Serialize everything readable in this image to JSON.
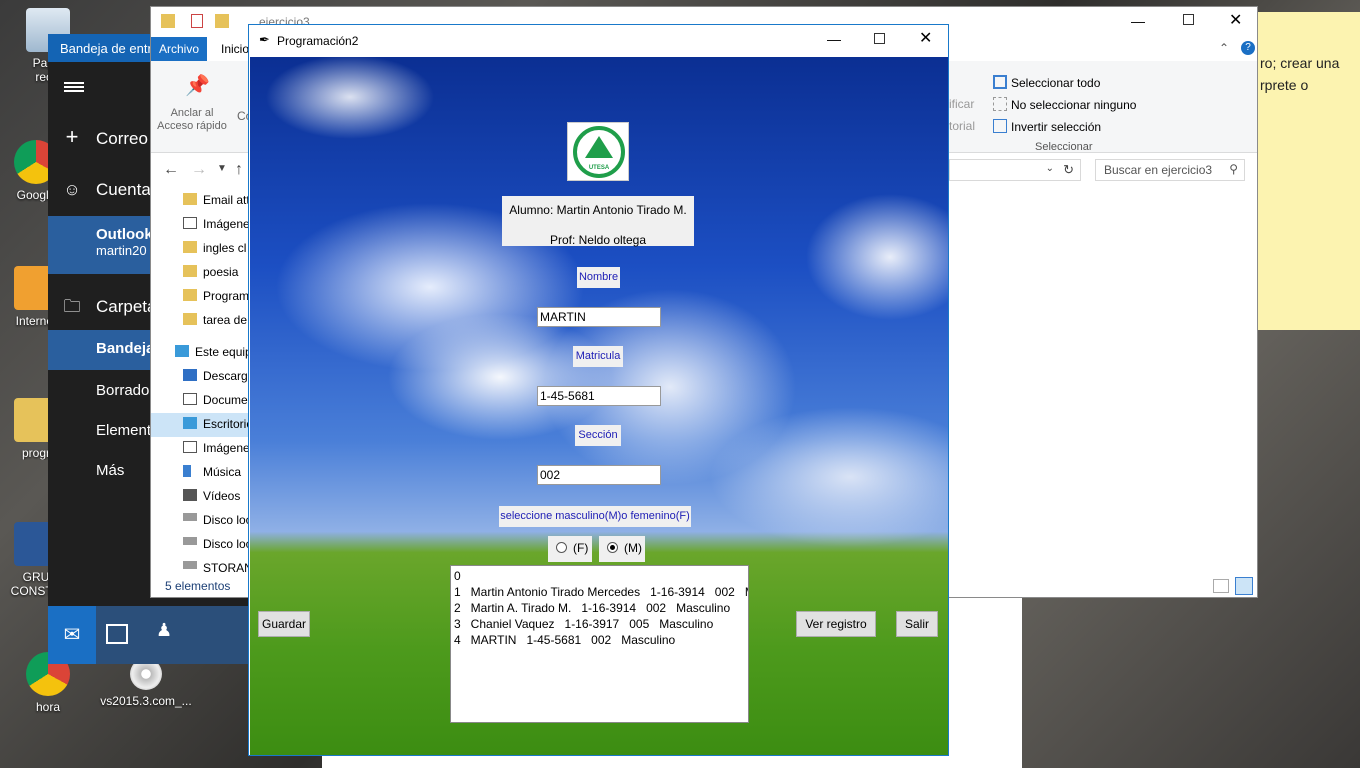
{
  "desktop": {
    "icons": [
      {
        "label": "Papelera de reciclaje",
        "short": "Papel",
        "short2": "recic"
      },
      {
        "label": "Google",
        "short": "Google"
      },
      {
        "label": "Internet",
        "short": "Internet"
      },
      {
        "label": "progr",
        "short": "progr"
      },
      {
        "label": "GRU CONSTR",
        "short": "GRU",
        "short2": "CONSTR"
      },
      {
        "label": "hora",
        "short": "hora"
      },
      {
        "label": "vs2015.3.com_...",
        "short": "vs2015.3.com_..."
      }
    ]
  },
  "sticky_note": {
    "text": "ro; crear una rprete o"
  },
  "mail": {
    "title": "Bandeja de entrada",
    "new_mail": "Correo",
    "accounts": "Cuentas",
    "account_name": "Outlook",
    "account_email": "martin20",
    "folders_header": "Carpetas",
    "folders": [
      "Bandeja",
      "Borrado",
      "Elementos",
      "Más"
    ]
  },
  "explorer": {
    "title": "ejercicio3",
    "tab_file": "Archivo",
    "tab_home": "Inicio",
    "pin_label": "Anclar al Acceso rápido",
    "copy_label": "Co",
    "select_all": "Seleccionar todo",
    "select_none": "No seleccionar ninguno",
    "invert_selection": "Invertir selección",
    "select_group": "Seleccionar",
    "edit_partial": "ificar",
    "history_partial": "torial",
    "search_placeholder": "Buscar en ejercicio3",
    "nav_items": [
      "Email att",
      "Imágene",
      "ingles cl",
      "poesia",
      "Program",
      "tarea de",
      "Este equip",
      "Descarga",
      "Docume",
      "Escritorio",
      "Imágene",
      "Música",
      "Vídeos",
      "Disco loc",
      "Disco loc",
      "STORAN"
    ],
    "status": "5 elementos"
  },
  "dialog": {
    "title": "Programación2",
    "student": "Alumno: Martin Antonio Tirado M.",
    "professor": "Prof: Neldo oltega",
    "logo_text": "UTESA",
    "nombre_label": "Nombre",
    "nombre_value": "MARTIN",
    "matricula_label": "Matricula",
    "matricula_value": "1-45-5681",
    "seccion_label": "Sección",
    "seccion_value": "002",
    "sexo_label": "seleccione masculino(M)o femenino(F)",
    "radio_f": "(F)",
    "radio_m": "(M)",
    "radio_selected": "M",
    "list_items": [
      "0",
      "1   Martin Antonio Tirado Mercedes   1-16-3914   002   M",
      "2   Martin A. Tirado M.   1-16-3914   002   Masculino",
      "3   Chaniel Vaquez   1-16-3917   005   Masculino",
      "4   MARTIN   1-45-5681   002   Masculino"
    ],
    "btn_guardar": "Guardar",
    "btn_ver": "Ver registro",
    "btn_salir": "Salir"
  }
}
